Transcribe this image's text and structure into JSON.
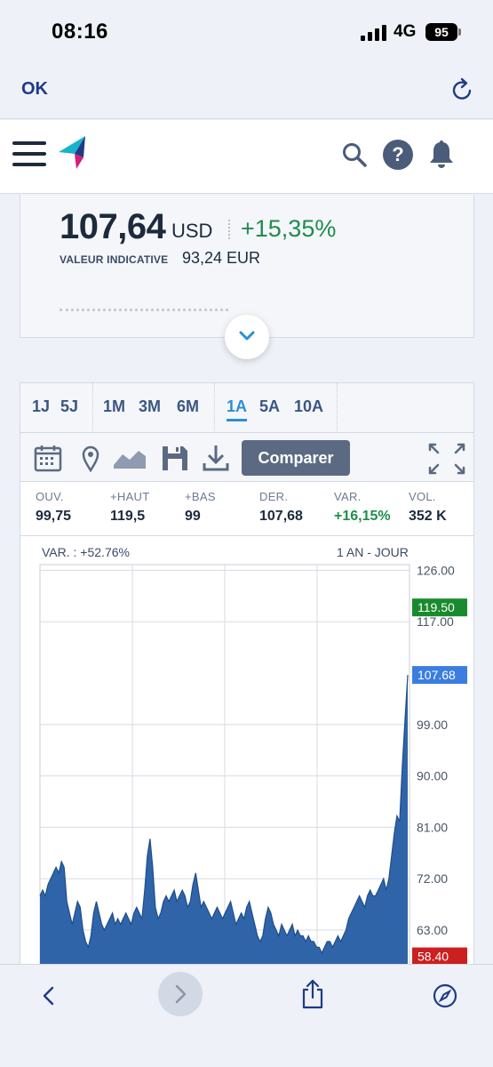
{
  "status_bar": {
    "time": "08:16",
    "network": "4G",
    "battery": "95"
  },
  "browser": {
    "done_label": "OK",
    "reload_icon": "reload-icon"
  },
  "header": {
    "menu_icon": "hamburger-menu-icon",
    "logo": "brand-logo",
    "search_icon": "search-icon",
    "help_icon": "help-icon",
    "help_glyph": "?",
    "bell_icon": "bell-icon"
  },
  "quote": {
    "price": "107,64",
    "currency": "USD",
    "change": "+15,35%",
    "indicative_label": "VALEUR INDICATIVE",
    "indicative_value": "93,24 EUR",
    "expand_icon": "chevron-down-icon"
  },
  "periods": [
    "1J",
    "5J",
    "1M",
    "3M",
    "6M",
    "1A",
    "5A",
    "10A"
  ],
  "active_period": "1A",
  "toolbar": {
    "calendar_icon": "calendar-icon",
    "location_icon": "location-pin-icon",
    "chart_type_icon": "area-chart-icon",
    "save_icon": "save-icon",
    "download_icon": "download-icon",
    "compare_label": "Comparer",
    "fullscreen_icon": "fullscreen-icon"
  },
  "stats": [
    {
      "label": "OUV.",
      "value": "99,75"
    },
    {
      "label": "+HAUT",
      "value": "119,5"
    },
    {
      "label": "+BAS",
      "value": "99"
    },
    {
      "label": "DER.",
      "value": "107,68"
    },
    {
      "label": "VAR.",
      "value": "+16,15%"
    },
    {
      "label": "VOL.",
      "value": "352 K"
    }
  ],
  "colors": {
    "positive": "#1f8d4e",
    "accent": "#2b8fd6",
    "series": "#2f64a8",
    "high_marker": "#1a8a2e",
    "last_marker": "#3b7de0",
    "low_marker": "#cc1f1f"
  },
  "chart_data": {
    "type": "area",
    "title": "",
    "header_left": "VAR. : +52.76%",
    "header_right": "1 AN - JOUR",
    "y_ticks": [
      "126.00",
      "117.00",
      "99.00",
      "90.00",
      "81.00",
      "72.00",
      "63.00"
    ],
    "ylim": [
      56,
      127
    ],
    "grid": true,
    "markers": {
      "high": "119.50",
      "last": "107.68",
      "low": "58.40"
    },
    "series": [
      {
        "values": [
          69,
          70,
          69,
          71,
          72,
          73,
          74,
          73,
          75,
          74,
          68,
          66,
          64,
          66,
          68,
          67,
          63,
          61,
          60,
          62,
          66,
          68,
          66,
          64,
          63,
          64,
          65,
          66,
          64,
          65,
          64,
          65,
          66,
          65,
          64,
          66,
          67,
          66,
          65,
          70,
          76,
          79,
          74,
          67,
          65,
          66,
          68,
          69,
          68,
          69,
          70,
          68,
          69,
          70,
          69,
          67,
          68,
          71,
          73,
          70,
          67,
          68,
          67,
          66,
          65,
          66,
          67,
          66,
          65,
          66,
          67,
          68,
          66,
          64,
          65,
          66,
          65,
          67,
          68,
          66,
          64,
          62,
          61,
          62,
          65,
          67,
          66,
          64,
          63,
          62,
          64,
          63,
          62,
          63,
          64,
          62,
          63,
          62,
          62,
          61,
          62,
          61,
          61,
          60,
          60,
          59,
          60,
          61,
          61,
          60,
          61,
          62,
          61,
          62,
          63,
          65,
          66,
          67,
          68,
          69,
          68,
          67,
          69,
          70,
          69,
          69,
          70,
          71,
          72,
          70,
          72,
          76,
          80,
          83,
          82,
          92,
          100,
          107.68
        ]
      }
    ]
  },
  "bottom_bar": {
    "back_icon": "back-arrow-icon",
    "forward_icon": "forward-arrow-icon",
    "share_icon": "share-icon",
    "compass_icon": "compass-icon"
  }
}
